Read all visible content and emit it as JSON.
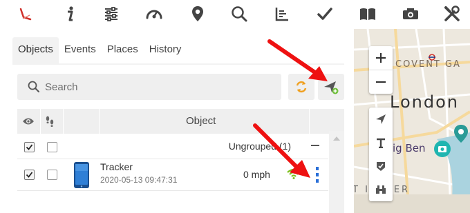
{
  "toolbar": {
    "icons": [
      "logo-icon",
      "info-icon",
      "settings-sliders-icon",
      "speedometer-icon",
      "location-pin-icon",
      "search-zoom-icon",
      "chart-icon",
      "checkmark-icon",
      "book-icon",
      "camera-icon",
      "tools-icon"
    ]
  },
  "tabs": {
    "objects": "Objects",
    "events": "Events",
    "places": "Places",
    "history": "History"
  },
  "search": {
    "placeholder": "Search"
  },
  "table": {
    "header_object": "Object",
    "group_label": "Ungrouped (1)",
    "rows": [
      {
        "name": "Tracker",
        "time": "2020-05-13 09:47:31",
        "speed": "0 mph",
        "visible": true,
        "follow": false
      }
    ]
  },
  "map": {
    "labels": {
      "covent_garden": "COVENT GA",
      "london": "London",
      "big_ben": "ig Ben",
      "westminster": "T INSTER"
    }
  },
  "colors": {
    "accent_red": "#d0302b",
    "signal_green": "#7cc11b",
    "phone_blue": "#2f7fd6",
    "menu_blue": "#2a6fd8",
    "refresh_orange": "#f0a020",
    "add_green": "#6fbf3a",
    "annotation_red": "#ee1111"
  }
}
